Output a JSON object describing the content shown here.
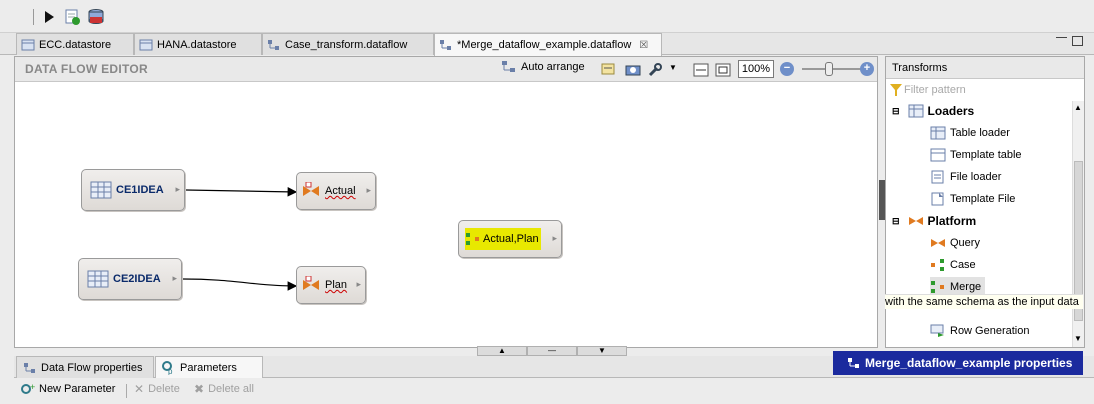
{
  "editor_tabs": [
    {
      "label": "ECC.datastore"
    },
    {
      "label": "HANA.datastore"
    },
    {
      "label": "Case_transform.dataflow"
    },
    {
      "label": "*Merge_dataflow_example.dataflow"
    }
  ],
  "editor": {
    "title": "DATA FLOW EDITOR",
    "auto_arrange": "Auto arrange",
    "zoom": "100%"
  },
  "nodes": {
    "ce1idea": "CE1IDEA",
    "ce2idea": "CE2IDEA",
    "actual": "Actual",
    "plan": "Plan",
    "merge": "Actual,Plan"
  },
  "transforms": {
    "title": "Transforms",
    "filter_placeholder": "Filter pattern",
    "loaders_label": "Loaders",
    "table_loader": "Table loader",
    "template_table": "Template table",
    "file_loader": "File loader",
    "template_file": "Template File",
    "platform_label": "Platform",
    "query": "Query",
    "case": "Case",
    "merge": "Merge",
    "row_generation": "Row Generation",
    "tooltip": "with the same schema as the input data"
  },
  "bottom": {
    "tab_properties": "Data Flow properties",
    "tab_parameters": "Parameters",
    "properties_title": "Merge_dataflow_example properties",
    "new_parameter": "New Parameter",
    "delete": "Delete",
    "delete_all": "Delete all"
  }
}
